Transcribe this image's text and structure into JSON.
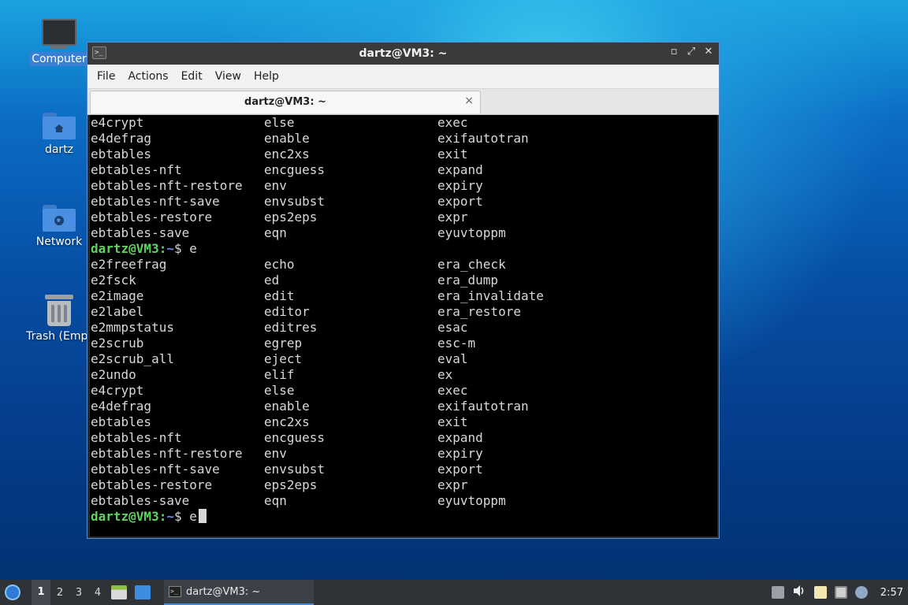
{
  "desktop": {
    "icons": [
      {
        "label": "Computer",
        "icon": "computer-icon"
      },
      {
        "label": "dartz",
        "icon": "home-folder-icon"
      },
      {
        "label": "Network",
        "icon": "network-folder-icon"
      },
      {
        "label": "Trash (Empt",
        "icon": "trash-icon"
      }
    ]
  },
  "window": {
    "title": "dartz@VM3: ~",
    "menu": [
      "File",
      "Actions",
      "Edit",
      "View",
      "Help"
    ],
    "tab_title": "dartz@VM3: ~",
    "tab_close": "×",
    "controls": {
      "minimize": "▫",
      "maximize": "⤢",
      "close": "✕"
    }
  },
  "terminal": {
    "prompt_user": "dartz@VM3",
    "prompt_colon": ":",
    "prompt_path": "~",
    "prompt_dollar": "$ e",
    "block1": [
      [
        "e4crypt",
        "else",
        "exec"
      ],
      [
        "e4defrag",
        "enable",
        "exifautotran"
      ],
      [
        "ebtables",
        "enc2xs",
        "exit"
      ],
      [
        "ebtables-nft",
        "encguess",
        "expand"
      ],
      [
        "ebtables-nft-restore",
        "env",
        "expiry"
      ],
      [
        "ebtables-nft-save",
        "envsubst",
        "export"
      ],
      [
        "ebtables-restore",
        "eps2eps",
        "expr"
      ],
      [
        "ebtables-save",
        "eqn",
        "eyuvtoppm"
      ]
    ],
    "block2": [
      [
        "e2freefrag",
        "echo",
        "era_check"
      ],
      [
        "e2fsck",
        "ed",
        "era_dump"
      ],
      [
        "e2image",
        "edit",
        "era_invalidate"
      ],
      [
        "e2label",
        "editor",
        "era_restore"
      ],
      [
        "e2mmpstatus",
        "editres",
        "esac"
      ],
      [
        "e2scrub",
        "egrep",
        "esc-m"
      ],
      [
        "e2scrub_all",
        "eject",
        "eval"
      ],
      [
        "e2undo",
        "elif",
        "ex"
      ],
      [
        "e4crypt",
        "else",
        "exec"
      ],
      [
        "e4defrag",
        "enable",
        "exifautotran"
      ],
      [
        "ebtables",
        "enc2xs",
        "exit"
      ],
      [
        "ebtables-nft",
        "encguess",
        "expand"
      ],
      [
        "ebtables-nft-restore",
        "env",
        "expiry"
      ],
      [
        "ebtables-nft-save",
        "envsubst",
        "export"
      ],
      [
        "ebtables-restore",
        "eps2eps",
        "expr"
      ],
      [
        "ebtables-save",
        "eqn",
        "eyuvtoppm"
      ]
    ]
  },
  "taskbar": {
    "workspaces": [
      "1",
      "2",
      "3",
      "4"
    ],
    "task_label": "dartz@VM3: ~",
    "clock": "2:57"
  }
}
